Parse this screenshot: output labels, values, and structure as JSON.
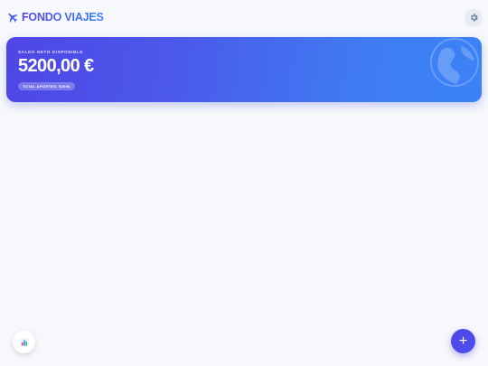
{
  "header": {
    "brand_icon": "airplane-icon",
    "brand_title": "FONDO VIAJES",
    "settings_icon": "gear-icon"
  },
  "balance_card": {
    "label": "SALDO NETO DISPONIBLE",
    "amount": "5200,00 €",
    "contributions_badge": "TOTAL APORTES: 5200€",
    "decoration_icon": "globe-icon"
  },
  "fab": {
    "stats_icon": "bar-chart-icon",
    "add_label": "+"
  },
  "colors": {
    "accent": "#4f46e5",
    "accent_secondary": "#3b82f6",
    "background": "#f7f8fb"
  }
}
